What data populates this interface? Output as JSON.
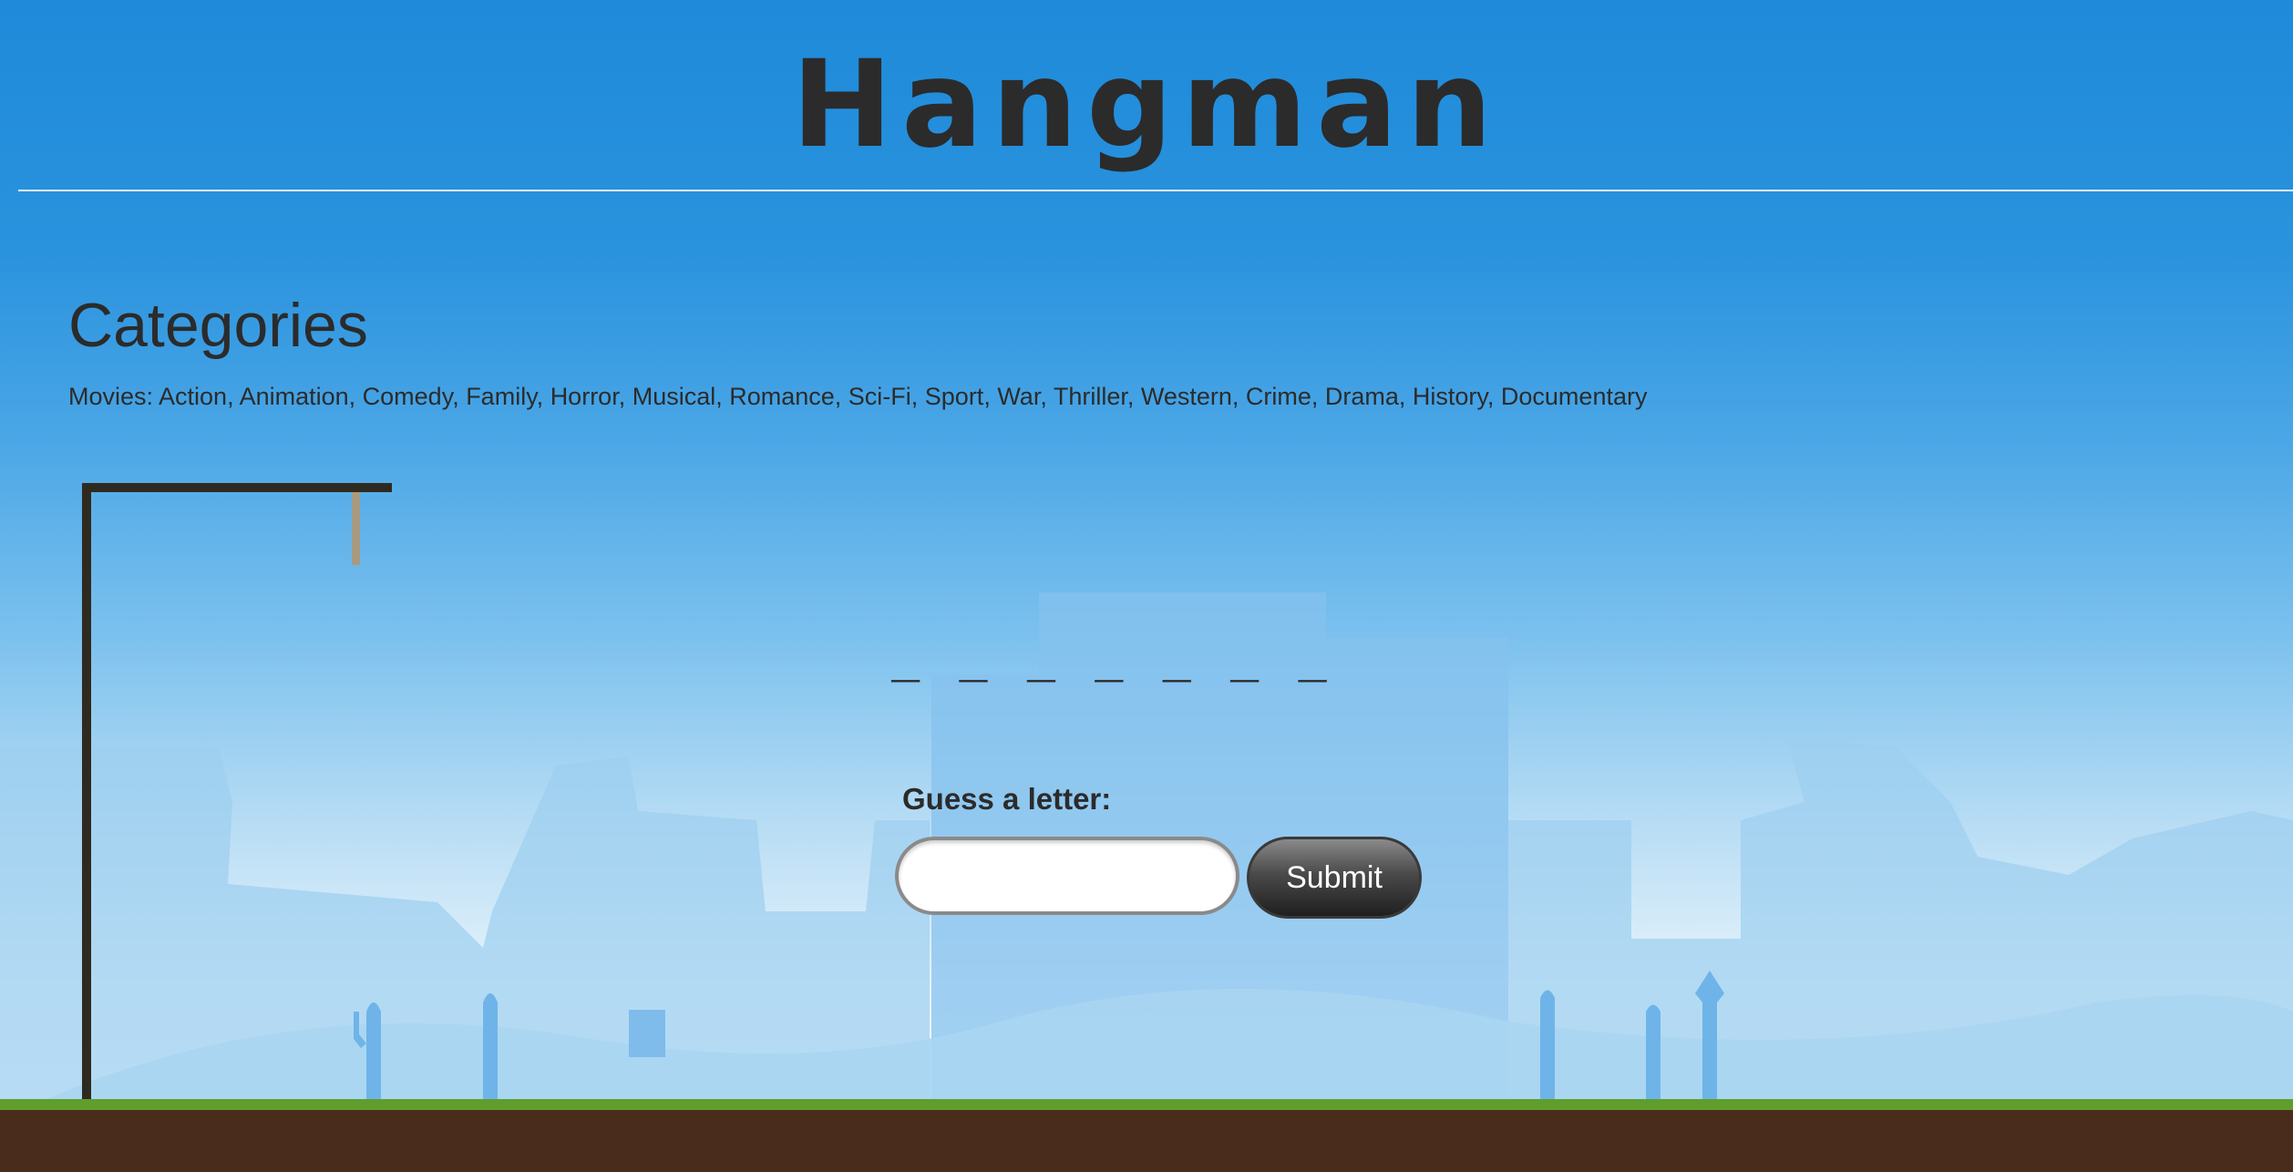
{
  "game": {
    "title": "Hangman"
  },
  "categories": {
    "heading": "Categories",
    "list": "Movies: Action, Animation, Comedy, Family, Horror, Musical, Romance, Sci-Fi, Sport, War, Thriller, Western, Crime, Drama, History, Documentary"
  },
  "word": {
    "blanks": "_ _ _ _ _ _ _",
    "letter_count": 7
  },
  "guess": {
    "label": "Guess a letter:",
    "input_value": "",
    "submit_label": "Submit"
  },
  "colors": {
    "sky_top": "#1e8ad9",
    "sky_bottom": "#f3f9fd",
    "text": "#2b2b2b",
    "gallows": "#2f2a20",
    "rope": "#a89a80",
    "soil": "#4a2c1c",
    "grass": "#5f9e2c",
    "silhouette": "#6fb4e8"
  }
}
